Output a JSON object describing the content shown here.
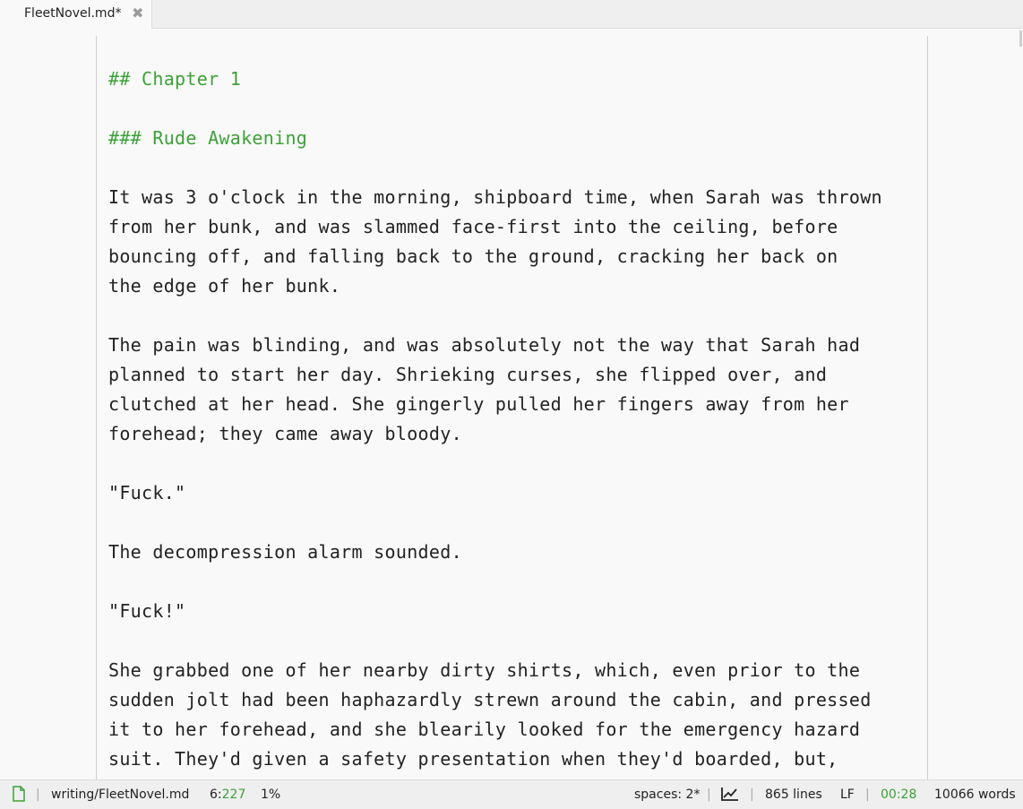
{
  "tab": {
    "title": "FleetNovel.md*",
    "close_glyph": "✖"
  },
  "document": {
    "heading1": "## Chapter 1",
    "heading2": "### Rude Awakening",
    "p1": [
      "It was 3 o'clock in the morning, shipboard time, when Sarah was thrown",
      "from her bunk, and was slammed face-first into the ceiling, before",
      "bouncing off, and falling back to the ground, cracking her back on",
      "the edge of her bunk."
    ],
    "p2": [
      "The pain was blinding, and was absolutely not the way that Sarah had",
      "planned to start her day. Shrieking curses, she flipped over, and",
      "clutched at her head. She gingerly pulled her fingers away from her",
      "forehead; they came away bloody."
    ],
    "p3": "\"Fuck.\"",
    "p4": "The decompression alarm sounded.",
    "p5": "\"Fuck!\"",
    "p6": [
      "She grabbed one of her nearby dirty shirts, which, even prior to the",
      "sudden jolt had been haphazardly strewn around the cabin, and pressed",
      "it to her forehead, and she blearily looked for the emergency hazard",
      "suit. They'd given a safety presentation when they'd boarded, but,"
    ]
  },
  "status": {
    "file_icon": "file-icon",
    "path": "writing/FleetNovel.md",
    "line": "6:",
    "column": "227",
    "percent": "1%",
    "indent": "spaces: 2*",
    "chart_icon": "chart-icon",
    "lines": "865 lines",
    "line_ending": "LF",
    "timer": "00:28",
    "words": "10066 words",
    "separator": "|"
  },
  "colors": {
    "heading": "#3aa335",
    "accent_green": "#3aa335",
    "text": "#222222",
    "background": "#f9f9f9"
  }
}
